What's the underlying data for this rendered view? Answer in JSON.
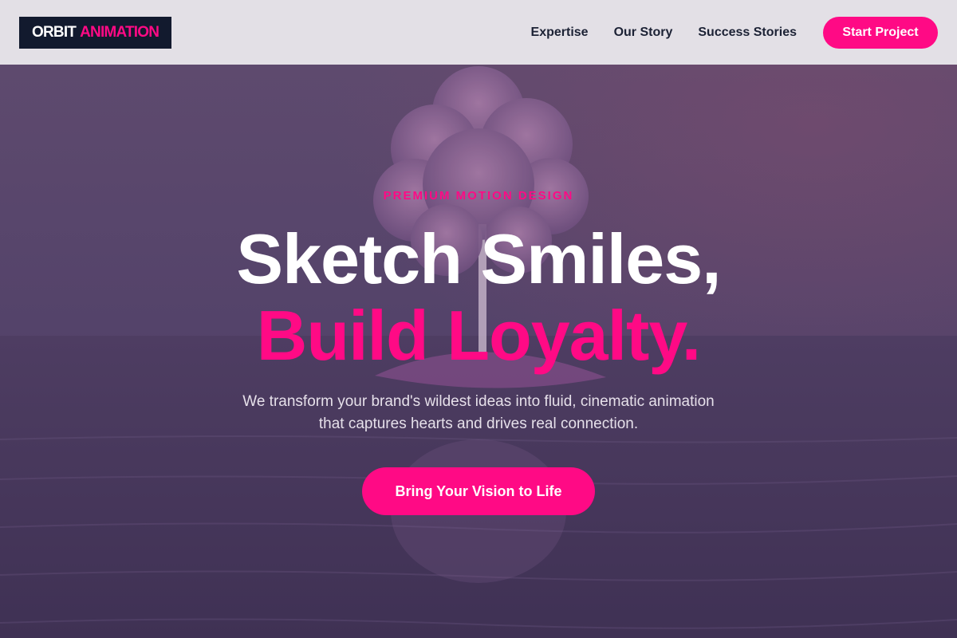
{
  "brand": {
    "name_part1": "ORBIT",
    "name_part2": "ANIMATION"
  },
  "nav": {
    "items": [
      {
        "label": "Expertise"
      },
      {
        "label": "Our Story"
      },
      {
        "label": "Success Stories"
      }
    ],
    "cta_label": "Start Project"
  },
  "hero": {
    "eyebrow": "PREMIUM MOTION DESIGN",
    "headline_line1": "Sketch Smiles,",
    "headline_line2": "Build Loyalty.",
    "subtitle_line1": "We transform your brand's wildest ideas into fluid, cinematic animation",
    "subtitle_line2": "that captures hearts and drives real connection.",
    "cta_label": "Bring Your Vision to Life",
    "background_description_icon": "pink-tree-island-image"
  },
  "colors": {
    "accent": "#ff0a85",
    "header_bg": "#e3e0e6",
    "logo_bg": "#121a2e",
    "nav_text": "#1c2235",
    "hero_overlay": "#4a3a5c"
  }
}
